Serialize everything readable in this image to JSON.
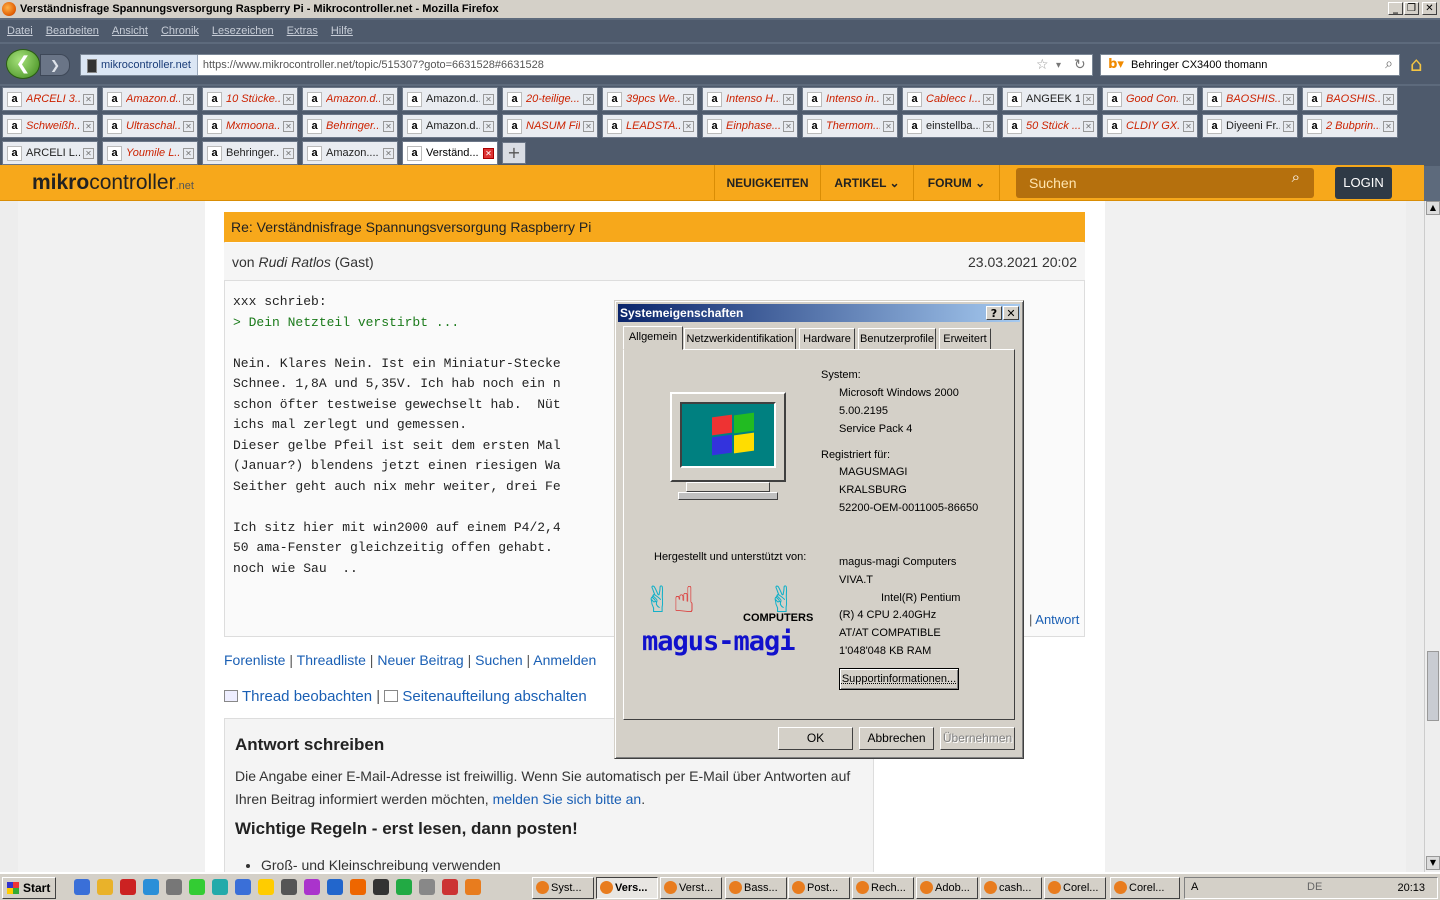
{
  "window": {
    "title": "Verständnisfrage Spannungsversorgung Raspberry Pi - Mikrocontroller.net - Mozilla Firefox"
  },
  "menu": [
    "Datei",
    "Bearbeiten",
    "Ansicht",
    "Chronik",
    "Lesezeichen",
    "Extras",
    "Hilfe"
  ],
  "nav": {
    "site_badge": "mikrocontroller.net",
    "url": "https://www.mikrocontroller.net/topic/515307?goto=6631528#6631528",
    "search_value": "Behringer CX3400 thomann"
  },
  "tabs": {
    "row1": [
      "ARCELI 3...",
      "Amazon.d...",
      "10 Stücke...",
      "Amazon.d...",
      "Amazon.d...",
      "20-teilige...",
      "39pcs We...",
      "Intenso H...",
      "Intenso in...",
      "Cablecc I...",
      "ANGEEK 1...",
      "Good Con...",
      "BAOSHIS...",
      "BAOSHIS..."
    ],
    "row2": [
      "Schweißh...",
      "Ultraschal...",
      "Mxmoona...",
      "Behringer...",
      "Amazon.d...",
      "NASUM Fil...",
      "LEADSTA...",
      "Einphase...",
      "Thermom...",
      "einstellba...",
      "50 Stück ...",
      "CLDIY GX...",
      "Diyeeni Fr...",
      "2 Bubprin..."
    ],
    "row3": [
      "ARCELI L...",
      "Youmile L...",
      "Behringer...",
      "Amazon....",
      "Verständ..."
    ]
  },
  "site": {
    "logo_bold": "mikro",
    "logo_rest": "controller",
    "logo_tld": ".net",
    "nav": [
      "NEUIGKEITEN",
      "ARTIKEL",
      "FORUM"
    ],
    "search_placeholder": "Suchen",
    "login": "LOGIN"
  },
  "post": {
    "title": "Re: Verständnisfrage Spannungsversorgung Raspberry Pi",
    "by_prefix": "von ",
    "author": "Rudi Ratlos",
    "author_suffix": " (Gast)",
    "date": "23.03.2021 20:02",
    "quote_head": "xxx schrieb:",
    "quote": "> Dein Netzteil verstirbt ...",
    "body": "Nein. Klares Nein. Ist ein Miniatur-Stecke\nSchnee. 1,8A und 5,35V. Ich hab noch ein n\nschon öfter testweise gewechselt hab.  Nüt\nichs mal zerlegt und gemessen.\nDieser gelbe Pfeil ist seit dem ersten Mal\n(Januar?) blendens jetzt einen riesigen Wa\nSeither geht auch nix mehr weiter, drei Fe\n\nIch sitz hier mit win2000 auf einem P4/2,4\n50 ama-Fenster gleichzeitig offen gehabt. \nnoch wie Sau  ..",
    "answer": "Antwort"
  },
  "links": [
    "Forenliste",
    "Threadliste",
    "Neuer Beitrag",
    "Suchen",
    "Anmelden"
  ],
  "watch": [
    "Thread beobachten",
    "Seitenaufteilung abschalten"
  ],
  "reply": {
    "heading": "Antwort schreiben",
    "text": "Die Angabe einer E-Mail-Adresse ist freiwillig. Wenn Sie automatisch per E-Mail über Antworten auf Ihren Beitrag informiert werden möchten, ",
    "link": "melden Sie sich bitte an",
    "link_after": ".",
    "rules": "Wichtige Regeln - erst lesen, dann posten!",
    "bullet": "Groß- und Kleinschreibung verwenden"
  },
  "dialog": {
    "title": "Systemeigenschaften",
    "tabs": [
      "Allgemein",
      "Netzwerkidentifikation",
      "Hardware",
      "Benutzerprofile",
      "Erweitert"
    ],
    "system_label": "System:",
    "system": [
      "Microsoft Windows 2000",
      "5.00.2195",
      "Service Pack 4"
    ],
    "reg_label": "Registriert für:",
    "reg": [
      "MAGUSMAGI",
      "KRALSBURG",
      "52200-OEM-0011005-86650"
    ],
    "made_by": "Hergestellt und unterstützt von:",
    "computer": [
      "magus-magi Computers",
      "VIVA.T",
      "Intel(R) Pentium",
      "(R) 4 CPU 2.40GHz",
      "AT/AT COMPATIBLE",
      "1'048'048 KB RAM"
    ],
    "logo_text": "magus-magi",
    "logo_computers": "COMPUTERS",
    "support": "Supportinformationen...",
    "ok": "OK",
    "cancel": "Abbrechen",
    "apply": "Übernehmen"
  },
  "taskbar": {
    "start": "Start",
    "tasks": [
      "Syst...",
      "Vers...",
      "Verst...",
      "Bass...",
      "Post...",
      "Rech...",
      "Adob...",
      "cash...",
      "Corel...",
      "Corel..."
    ],
    "tray_lang": "DE",
    "clock": "20:13"
  }
}
